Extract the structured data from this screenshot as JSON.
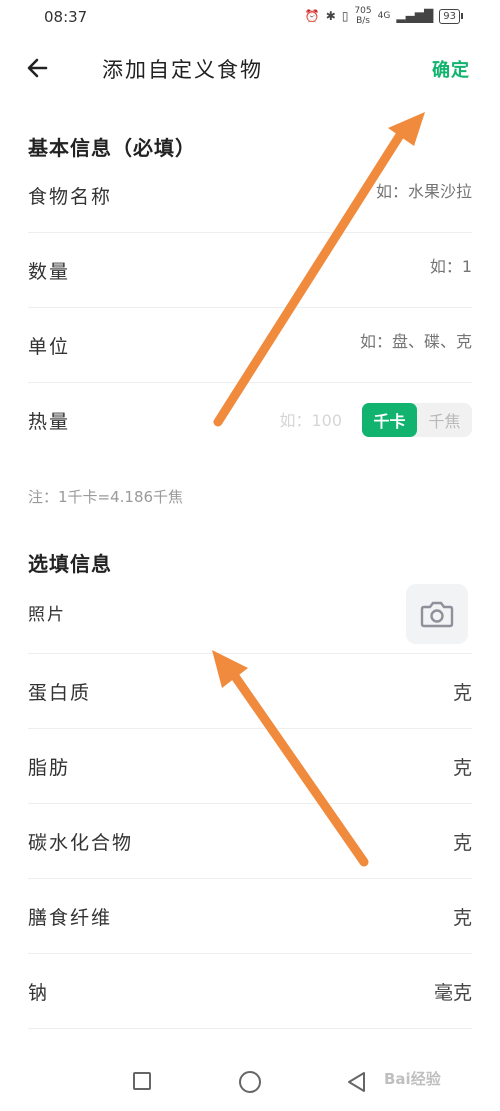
{
  "status_bar": {
    "time": "08:37",
    "speed_value": "705",
    "speed_unit": "B/s",
    "network": "4G",
    "battery": "93"
  },
  "header": {
    "title": "添加自定义食物",
    "confirm_label": "确定"
  },
  "required_section": {
    "title": "基本信息（必填）",
    "rows": [
      {
        "label": "食物名称",
        "placeholder": "如：水果沙拉"
      },
      {
        "label": "数量",
        "placeholder": "如：1"
      },
      {
        "label": "单位",
        "placeholder": "如：盘、碟、克"
      }
    ],
    "energy": {
      "label": "热量",
      "placeholder": "如：100",
      "unit_options": [
        "千卡",
        "千焦"
      ],
      "selected": "千卡"
    },
    "note": "注：1千卡=4.186千焦"
  },
  "optional_section": {
    "title": "选填信息",
    "photo_label": "照片",
    "rows": [
      {
        "label": "蛋白质",
        "unit": "克"
      },
      {
        "label": "脂肪",
        "unit": "克"
      },
      {
        "label": "碳水化合物",
        "unit": "克"
      },
      {
        "label": "膳食纤维",
        "unit": "克"
      },
      {
        "label": "钠",
        "unit": "毫克"
      }
    ]
  },
  "watermark": "Bai经验",
  "colors": {
    "accent": "#12b36e",
    "annotation_arrow": "#f08a3c"
  },
  "icons": [
    "back-arrow-icon",
    "camera-icon",
    "nav-square-icon",
    "nav-circle-icon",
    "nav-back-icon"
  ]
}
